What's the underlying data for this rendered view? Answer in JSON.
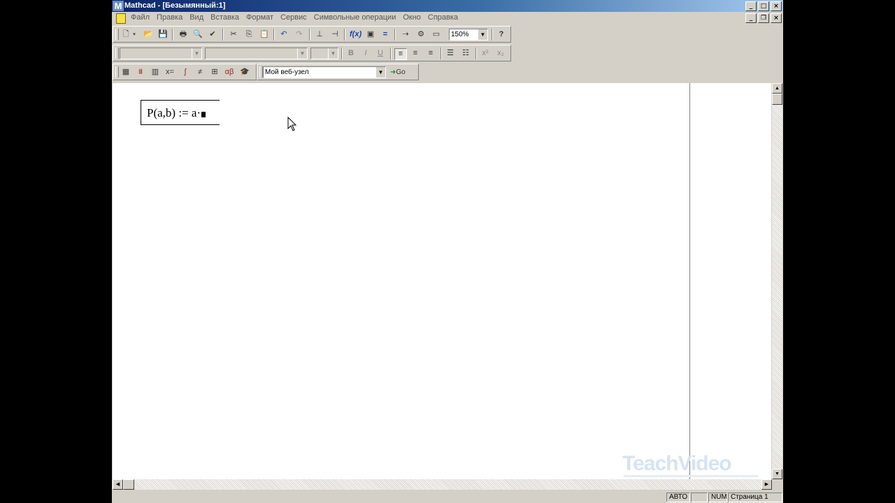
{
  "window": {
    "title": "Mathcad - [Безымянный:1]",
    "app_letter": "M"
  },
  "menu": {
    "items": [
      "Файл",
      "Правка",
      "Вид",
      "Вставка",
      "Формат",
      "Сервис",
      "Символьные операции",
      "Окно",
      "Справка"
    ]
  },
  "toolbar_standard": {
    "zoom_value": "150%"
  },
  "toolbar_web": {
    "url_value": "Мой веб-узел",
    "go_label": "Go"
  },
  "document": {
    "expression": "P(a,b) := a·"
  },
  "watermark": {
    "text": "TeachVideo"
  },
  "statusbar": {
    "mode": "АВТО",
    "num": "NUM",
    "page": "Страница 1"
  }
}
